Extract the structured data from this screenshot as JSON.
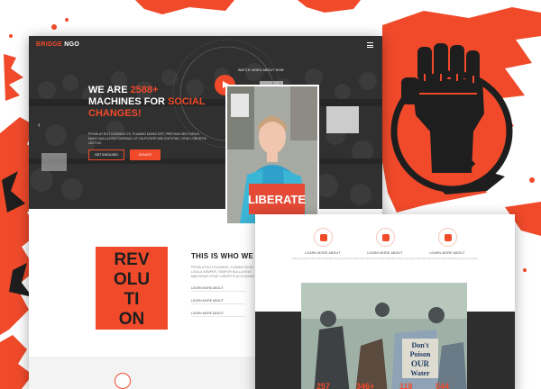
{
  "brand": {
    "name": "BRIDGE",
    "suffix": "NGO",
    "accent": "#f04a2a"
  },
  "hero": {
    "video_label": "WATCH VIDEO ABOUT HOW",
    "headline": {
      "line1_prefix": "WE ARE ",
      "line1_accent": "2588+",
      "line2": "MACHINES FOR ",
      "line2_accent": "SOCIAL",
      "line3_accent": "CHANGES!"
    },
    "description": "PROIN AT ELIT EUISMOD TE, FLAMMO MOMO ERT, PRETIUM SED PURUS. NUNC NULLA ERAT DAPIBUS, AT VULPUTATE NISI EGESTAS, VITAE LOBORTIS LECTUS.",
    "btn_outline": "GET INVOLVED",
    "btn_solid": "DONATE",
    "sign_text": "LIBERATE"
  },
  "about": {
    "logo_text": [
      "REV",
      "OLU",
      "TI",
      "ON"
    ],
    "title": "THIS IS WHO WE ARE",
    "description": "PROIN AT ELIT EUISMOD, FLAMMO NUNC LIGULA SEMPER, TEMPOR NULLA ERAT, MAECENAS VITAE LOBORTIS ACCUMSAN ELIT.",
    "links": [
      "LEARN MORE ABOUT",
      "LEARN MORE ABOUT",
      "LEARN MORE ABOUT"
    ]
  },
  "features": [
    {
      "title": "LEARN MORE ABOUT",
      "desc": "Duis sed odio sit amet nibh vulputate cursus a sit amet."
    },
    {
      "title": "LEARN MORE ABOUT",
      "desc": "Duis sed odio sit amet nibh vulputate cursus a sit amet."
    },
    {
      "title": "LEARN MORE ABOUT",
      "desc": "Duis sed odio sit amet nibh vulputate cursus a sit amet."
    }
  ],
  "sign2": {
    "line1": "Don't",
    "line2": "Poison",
    "line3": "OUR",
    "line4": "Water"
  },
  "stats": [
    "257",
    "346+",
    "118",
    "544"
  ]
}
